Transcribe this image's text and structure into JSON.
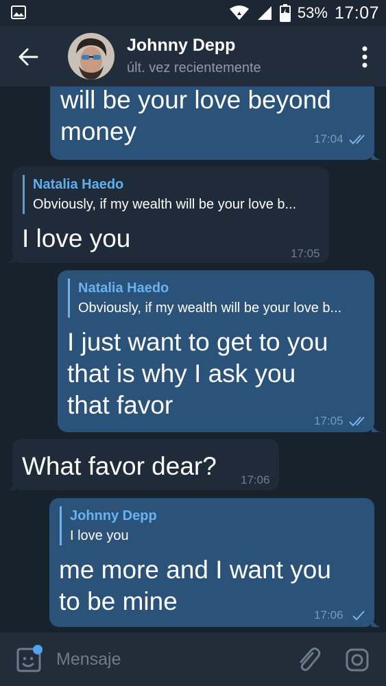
{
  "status_bar": {
    "battery": "53%",
    "time": "17:07",
    "icons": [
      "image-icon",
      "wifi-icon",
      "signal-icon",
      "battery-icon"
    ]
  },
  "header": {
    "name": "Johnny Depp",
    "status": "últ. vez recientemente",
    "icons": [
      "back-arrow-icon",
      "more-vertical-icon"
    ]
  },
  "messages": [
    {
      "direction": "out",
      "text_lines": [
        "will be your love beyond",
        "money"
      ],
      "time": "17:04",
      "read": true
    },
    {
      "direction": "in",
      "reply": {
        "name": "Natalia Haedo",
        "text": "Obviously, if my wealth will be your love b..."
      },
      "text_lines": [
        "I love you"
      ],
      "time": "17:05"
    },
    {
      "direction": "out",
      "reply": {
        "name": "Natalia Haedo",
        "text": "Obviously, if my wealth will be your love b..."
      },
      "text_lines": [
        "I just want to get to you",
        "that is why I ask you",
        "that favor"
      ],
      "time": "17:05",
      "read": true
    },
    {
      "direction": "in",
      "text_lines": [
        "What favor dear?"
      ],
      "time": "17:06"
    },
    {
      "direction": "out",
      "reply": {
        "name": "Johnny Depp",
        "text": "I love you"
      },
      "text_lines": [
        "me more and I want you",
        "to be mine"
      ],
      "time": "17:06",
      "read": false
    }
  ],
  "input": {
    "placeholder": "Mensaje",
    "icons": [
      "sticker-emoji-icon",
      "attach-paperclip-icon",
      "camera-icon"
    ]
  },
  "colors": {
    "background": "#18222d",
    "header": "#212d3b",
    "outgoing_bubble": "#2b5278",
    "incoming_bubble": "#1f2b38",
    "accent": "#6ab2f2"
  }
}
